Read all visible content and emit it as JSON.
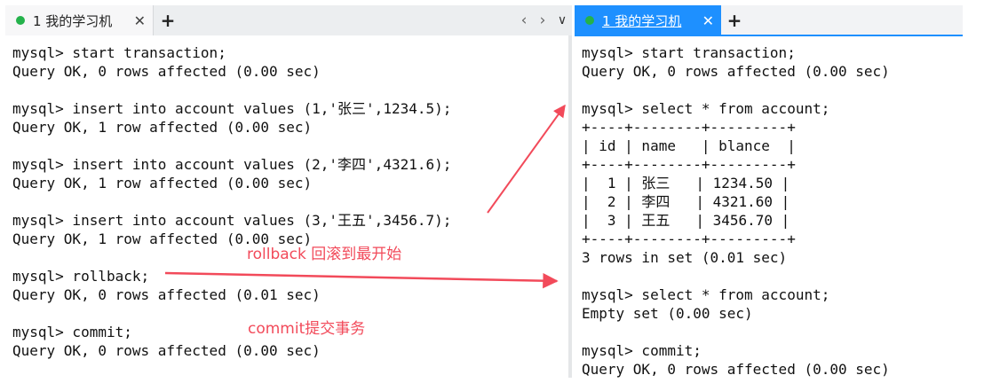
{
  "left_pane": {
    "tab_label": "1 我的学习机",
    "close_glyph": "✕",
    "plus_glyph": "+",
    "nav_prev": "‹",
    "nav_next": "›",
    "nav_menu": "∨",
    "terminal_text": "mysql> start transaction;\nQuery OK, 0 rows affected (0.00 sec)\n\nmysql> insert into account values (1,'张三',1234.5);\nQuery OK, 1 row affected (0.00 sec)\n\nmysql> insert into account values (2,'李四',4321.6);\nQuery OK, 1 row affected (0.00 sec)\n\nmysql> insert into account values (3,'王五',3456.7);\nQuery OK, 1 row affected (0.00 sec)\n\nmysql> rollback;\nQuery OK, 0 rows affected (0.01 sec)\n\nmysql> commit;\nQuery OK, 0 rows affected (0.00 sec)"
  },
  "right_pane": {
    "tab_label": "1 我的学习机",
    "close_glyph": "✕",
    "plus_glyph": "+",
    "terminal_text": "mysql> start transaction;\nQuery OK, 0 rows affected (0.00 sec)\n\nmysql> select * from account;\n+----+--------+---------+\n| id | name   | blance  |\n+----+--------+---------+\n|  1 | 张三   | 1234.50 |\n|  2 | 李四   | 4321.60 |\n|  3 | 王五   | 3456.70 |\n+----+--------+---------+\n3 rows in set (0.01 sec)\n\nmysql> select * from account;\nEmpty set (0.00 sec)\n\nmysql> commit;\nQuery OK, 0 rows affected (0.00 sec)"
  },
  "annotations": {
    "rollback_note": "rollback 回滚到最开始",
    "commit_note": "commit提交事务"
  },
  "colors": {
    "active_tab": "#1e90ff",
    "status_dot": "#24b24b",
    "annotation": "#f24a5a"
  }
}
